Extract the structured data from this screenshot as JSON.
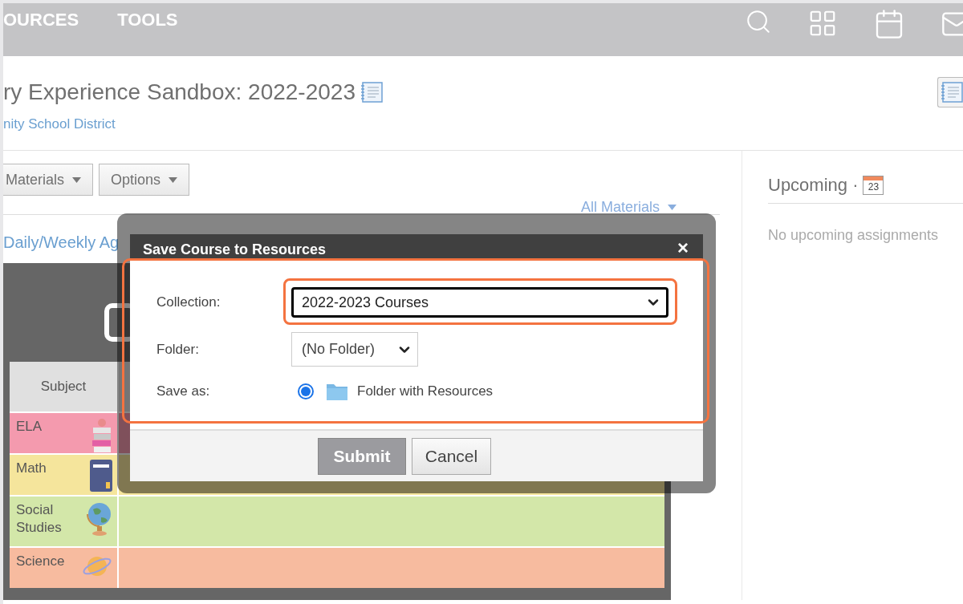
{
  "top_nav": {
    "items": [
      "OURCES",
      "TOOLS"
    ]
  },
  "header": {
    "title": "ry Experience Sandbox: 2022-2023",
    "subtitle": "nity School District"
  },
  "toolbar": {
    "buttons": [
      "Materials",
      "Options"
    ],
    "filter": "All Materials",
    "link": "Daily/Weekly Ag"
  },
  "schedule_table": {
    "header": "Subject",
    "rows": [
      {
        "label": "ELA",
        "color": "#f49aae",
        "kind": "books"
      },
      {
        "label": "Math",
        "color": "#f5e59c",
        "kind": "calculator"
      },
      {
        "label": "Social Studies",
        "color": "#d3e7a9",
        "kind": "globe"
      },
      {
        "label": "Science",
        "color": "#f7bb9f",
        "kind": "planet"
      }
    ]
  },
  "upcoming": {
    "title": "Upcoming ·",
    "calendar_day": "23",
    "empty_text": "No upcoming assignments"
  },
  "dialog": {
    "title": "Save Course to Resources",
    "close": "×",
    "highlighted": true,
    "fields": [
      {
        "kind": "select",
        "label": "Collection:",
        "value": "2022-2023 Courses",
        "highlighted": true
      },
      {
        "kind": "select",
        "label": "Folder:",
        "value": "(No Folder)",
        "highlighted": false
      },
      {
        "kind": "radio",
        "label": "Save as:",
        "option": "Folder with Resources",
        "selected": true
      }
    ],
    "buttons": [
      {
        "label": "Submit",
        "kind": "primary"
      },
      {
        "label": "Cancel",
        "kind": "secondary"
      }
    ]
  }
}
